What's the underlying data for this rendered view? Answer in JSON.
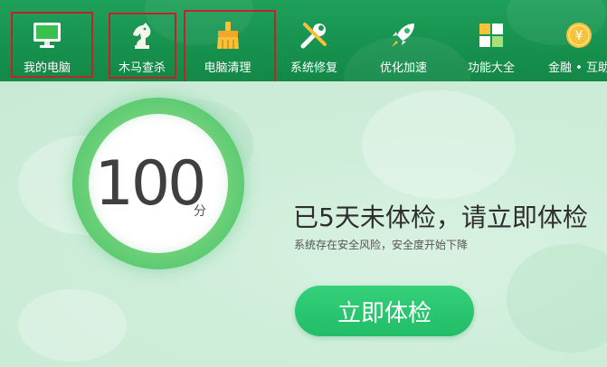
{
  "toolbar": {
    "items": [
      {
        "label": "我的电脑",
        "icon": "monitor-icon"
      },
      {
        "label": "木马查杀",
        "icon": "horse-icon"
      },
      {
        "label": "电脑清理",
        "icon": "broom-icon"
      },
      {
        "label": "系统修复",
        "icon": "wrench-icon"
      },
      {
        "label": "优化加速",
        "icon": "rocket-icon"
      },
      {
        "label": "功能大全",
        "icon": "apps-grid-icon"
      },
      {
        "label": "金融 • 互助",
        "icon": "yuan-coin-icon"
      }
    ]
  },
  "main": {
    "score": "100",
    "score_unit": "分",
    "headline": "已5天未体检，请立即体检",
    "subline": "系统存在安全风险，安全度开始下降",
    "cta_label": "立即体检"
  },
  "colors": {
    "toolbar_green": "#17924f",
    "cta_green": "#22bd66",
    "highlight_red": "#c0242a"
  }
}
